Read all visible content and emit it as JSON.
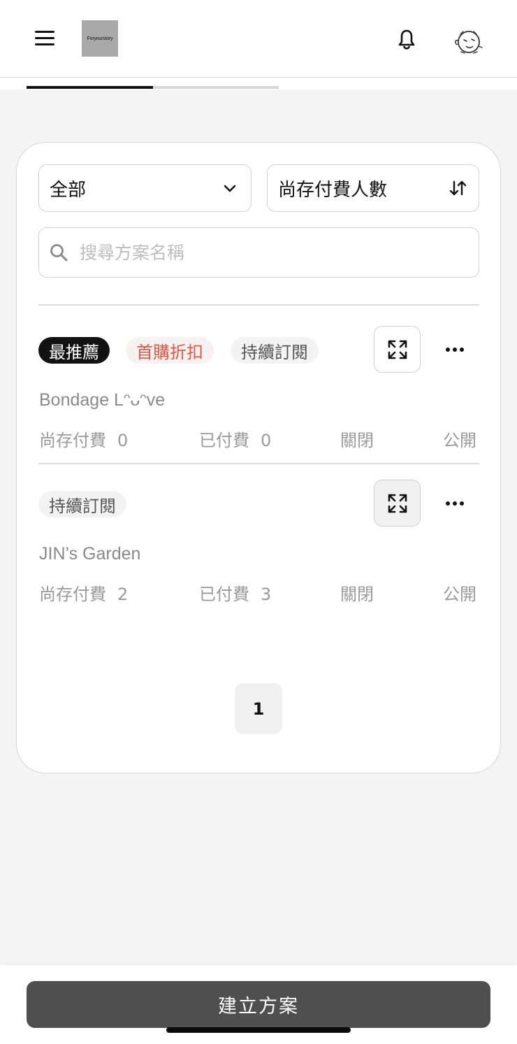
{
  "header": {
    "logo_text": "Foryourstory",
    "menu_icon": "hamburger-menu-icon",
    "notification_icon": "bell-icon",
    "avatar_icon": "avatar-doodle-icon"
  },
  "tabs": [
    {
      "state": "active"
    },
    {
      "state": "inactive"
    }
  ],
  "filters": {
    "category_value": "全部",
    "category_icon": "chevron-down-icon",
    "sort_value": "尚存付費人數",
    "sort_icon": "sort-arrows-icon"
  },
  "search": {
    "placeholder": "搜尋方案名稱",
    "value": "",
    "icon": "search-icon"
  },
  "plans": [
    {
      "tags": [
        "最推薦",
        "首購折扣",
        "持續訂閱"
      ],
      "title": "Bondage Lᵔᴗᵔve",
      "active_paid_label": "尚存付費",
      "active_paid_value": "0",
      "paid_label": "已付費",
      "paid_value": "0",
      "status": "關閉",
      "visibility": "公開"
    },
    {
      "tags": [
        "持續訂閱"
      ],
      "title": "JIN’s Garden",
      "active_paid_label": "尚存付費",
      "active_paid_value": "2",
      "paid_label": "已付費",
      "paid_value": "3",
      "status": "關閉",
      "visibility": "公開"
    }
  ],
  "pagination": {
    "current_page": "1"
  },
  "footer": {
    "create_label": "建立方案"
  },
  "colors": {
    "tag_dark_bg": "#121212",
    "tag_red_text": "#e8553f",
    "create_button_bg": "#4f4f4f",
    "page_bg": "#f4f4f4"
  }
}
